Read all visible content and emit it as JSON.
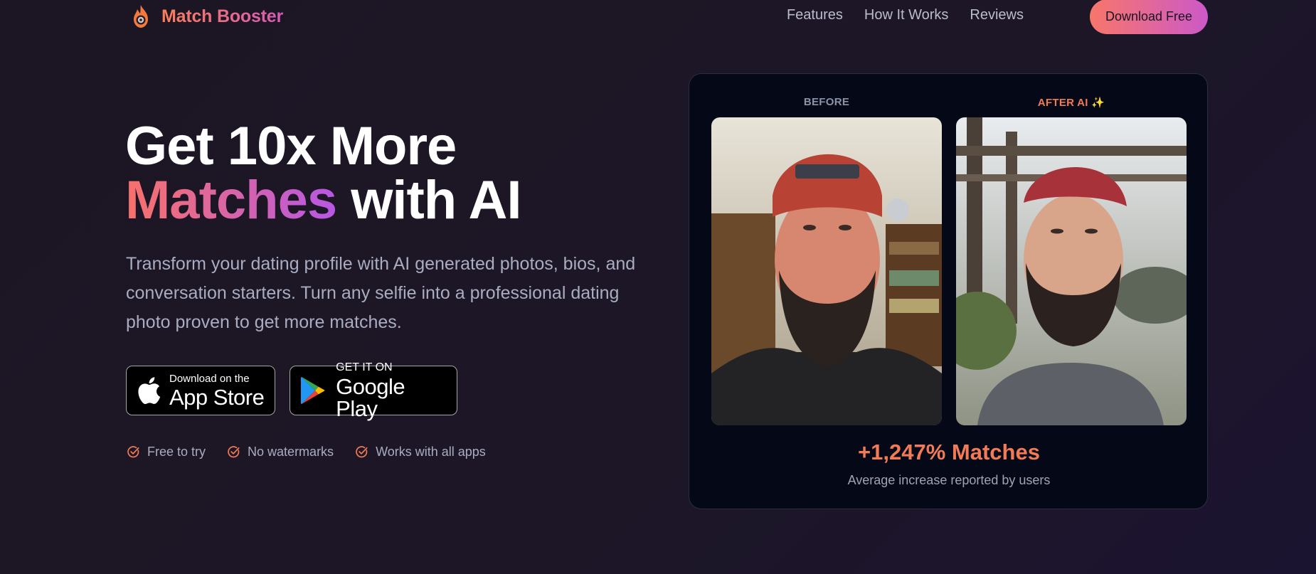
{
  "brand": {
    "name": "Match Booster",
    "logo_icon": "flame-icon"
  },
  "nav": {
    "links": [
      "Features",
      "How It Works",
      "Reviews"
    ],
    "cta_label": "Download Free"
  },
  "hero": {
    "headline_line1": "Get 10x More",
    "headline_highlight": "Matches",
    "headline_rest": "with AI",
    "subtitle": "Transform your dating profile with AI generated photos, bios, and conversation starters. Turn any selfie into a professional dating photo proven to get more matches."
  },
  "stores": {
    "apple": {
      "small": "Download on the",
      "big": "App Store",
      "icon": "apple-icon"
    },
    "google": {
      "small": "GET IT ON",
      "big": "Google Play",
      "icon": "google-play-icon"
    }
  },
  "features": [
    "Free to try",
    "No watermarks",
    "Works with all apps"
  ],
  "comparison": {
    "before_label": "BEFORE",
    "after_label": "AFTER AI ✨",
    "stat_value": "+1,247% Matches",
    "stat_caption": "Average increase reported by users"
  },
  "colors": {
    "background": "#1c1524",
    "accent_orange": "#f27b56",
    "accent_pink": "#cc59c8",
    "muted_text": "#a8adc2",
    "card_bg": "#050816"
  }
}
